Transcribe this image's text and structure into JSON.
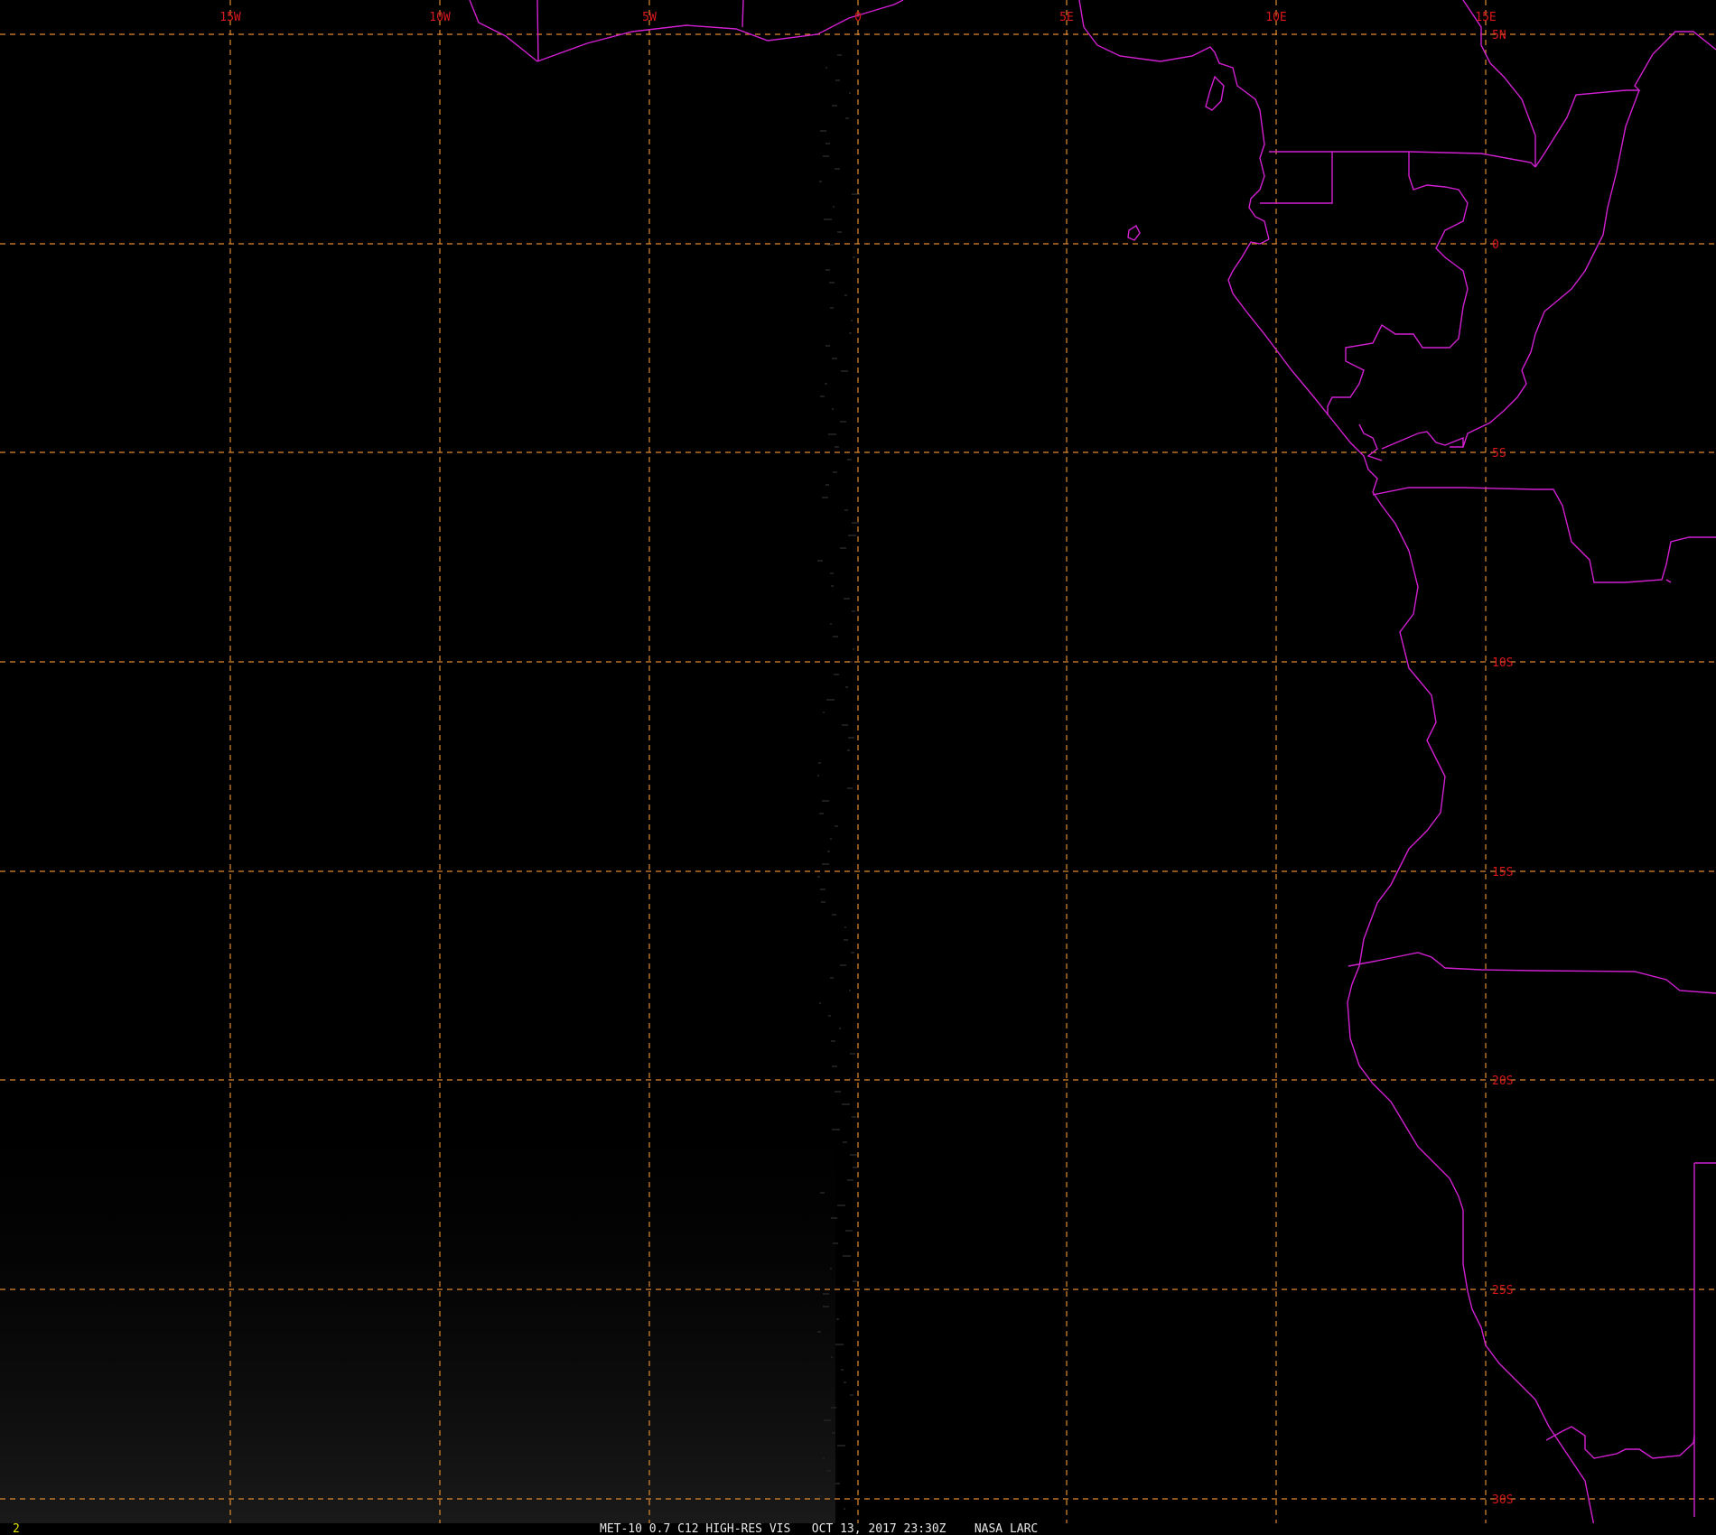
{
  "map": {
    "longitude_labels": [
      "15W",
      "10W",
      "5W",
      "0",
      "5E",
      "10E",
      "15E"
    ],
    "latitude_labels": [
      "5N",
      "0",
      "5S",
      "10S",
      "15S",
      "20S",
      "25S",
      "30S"
    ],
    "colors": {
      "background": "#000000",
      "gridlines": "#e08a30",
      "grid_labels": "#d8181c",
      "coastlines_borders": "#d020d0",
      "caption": "#e8e8e8",
      "frame_number": "#e0e000"
    }
  },
  "status_bar": {
    "frame_number": "2",
    "caption": "MET-10 0.7 C12 HIGH-RES VIS   OCT 13, 2017 23:30Z    NASA LARC"
  }
}
